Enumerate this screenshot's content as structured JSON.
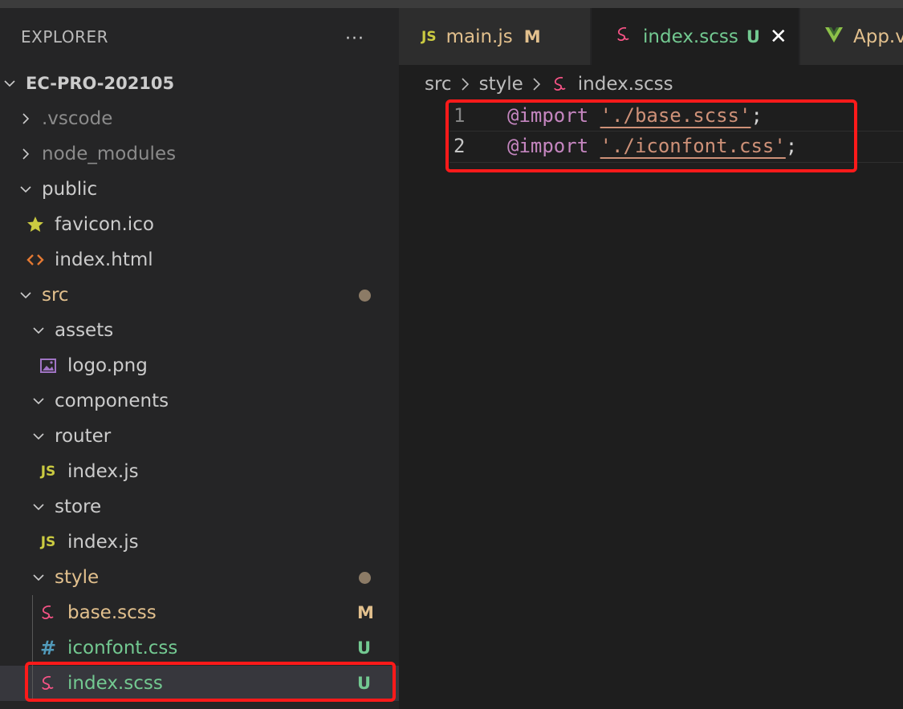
{
  "sidebar": {
    "title": "EXPLORER",
    "more_actions": "···",
    "tree": [
      {
        "label": "EC-PRO-202105",
        "type": "root",
        "expanded": true
      },
      {
        "label": ".vscode",
        "type": "folder",
        "expanded": false
      },
      {
        "label": "node_modules",
        "type": "folder",
        "expanded": false
      },
      {
        "label": "public",
        "type": "folder",
        "expanded": true
      },
      {
        "label": "favicon.ico",
        "type": "file",
        "icon": "star-icon"
      },
      {
        "label": "index.html",
        "type": "file",
        "icon": "html-brackets-icon"
      },
      {
        "label": "src",
        "type": "folder",
        "expanded": true
      },
      {
        "label": "assets",
        "type": "folder",
        "expanded": true
      },
      {
        "label": "logo.png",
        "type": "file",
        "icon": "image-icon"
      },
      {
        "label": "components",
        "type": "folder",
        "expanded": true
      },
      {
        "label": "router",
        "type": "folder",
        "expanded": true
      },
      {
        "label": "index.js",
        "type": "file",
        "icon": "js-icon",
        "icon_text": "JS"
      },
      {
        "label": "store",
        "type": "folder",
        "expanded": true
      },
      {
        "label": "index.js",
        "type": "file",
        "icon": "js-icon",
        "icon_text": "JS"
      },
      {
        "label": "style",
        "type": "folder",
        "expanded": true
      },
      {
        "label": "base.scss",
        "type": "file",
        "icon": "sass-icon",
        "status": "M"
      },
      {
        "label": "iconfont.css",
        "type": "file",
        "icon": "css-hash-icon",
        "icon_text": "#",
        "status": "U"
      },
      {
        "label": "index.scss",
        "type": "file",
        "icon": "sass-icon",
        "status": "U",
        "selected": true
      }
    ]
  },
  "tabs": [
    {
      "label": "main.js",
      "icon_text": "JS",
      "status": "M"
    },
    {
      "label": "index.scss",
      "status": "U",
      "active": true
    },
    {
      "label": "App.v",
      "icon": "vue-icon"
    }
  ],
  "breadcrumb": [
    "src",
    "style",
    "index.scss"
  ],
  "editor": {
    "lines": [
      {
        "number": "1",
        "keyword": "@import",
        "string": "'./base.scss'",
        "end": ";"
      },
      {
        "number": "2",
        "keyword": "@import",
        "string": "'./iconfont.css'",
        "end": ";"
      }
    ]
  },
  "colors": {
    "modified": "#e2c08d",
    "untracked": "#73c991",
    "highlight_box": "#ff1a1a",
    "js_icon": "#cbcb41",
    "sass_icon": "#f55385",
    "css_icon": "#519aba",
    "html_icon": "#e37933",
    "vue_icon": "#8dc149"
  }
}
